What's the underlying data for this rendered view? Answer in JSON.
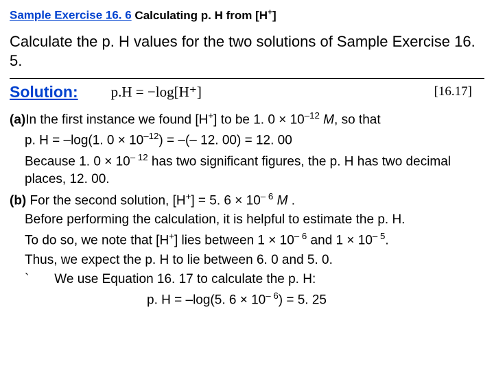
{
  "title": {
    "blue_prefix": "Sample Exercise 16. 6",
    "black_rest": " Calculating p. H from [H",
    "sup": "+",
    "black_close": "]"
  },
  "problem": "Calculate the p. H values for the two solutions of Sample Exercise 16. 5.",
  "solution_label": "Solution:",
  "equation": "p.H  =  −log[H⁺]",
  "equation_ref": "[16.17]",
  "a": {
    "label": "(a)",
    "line1_pre": "In the first instance we found [H",
    "line1_sup": "+",
    "line1_post": "] to be 1. 0 × 10",
    "line1_exp": "–12",
    "line1_M": " M",
    "line1_end": ", so that",
    "line2_pre": "p. H = –log(1. 0 × 10",
    "line2_exp": "–12",
    "line2_post": ") = –(– 12. 00) = 12. 00",
    "line3_pre": "Because 1. 0 × 10",
    "line3_exp": "– 12",
    "line3_post": " has two significant figures, the p. H has two decimal places, 12. 00."
  },
  "b": {
    "label": "(b)",
    "line1_pre": " For the second solution, [H",
    "line1_sup": "+",
    "line1_post": "] = 5. 6 × 10",
    "line1_exp": "– 6",
    "line1_M": " M ",
    "line1_end": ".",
    "line2": "Before performing the calculation, it is helpful to estimate the p. H.",
    "line3_pre": "To do so, we note that [H",
    "line3_sup": "+",
    "line3_mid": "] lies between 1 × 10",
    "line3_exp1": "– 6",
    "line3_mid2": " and 1 × 10",
    "line3_exp2": "– 5",
    "line3_end": ".",
    "line4": "Thus, we expect the p. H to lie between 6. 0 and 5. 0.",
    "line5": "`       We use Equation 16. 17 to calculate the p. H:",
    "line6_pre": "p. H = –log(5. 6 × 10",
    "line6_exp": "– 6",
    "line6_post": ") = 5. 25"
  }
}
